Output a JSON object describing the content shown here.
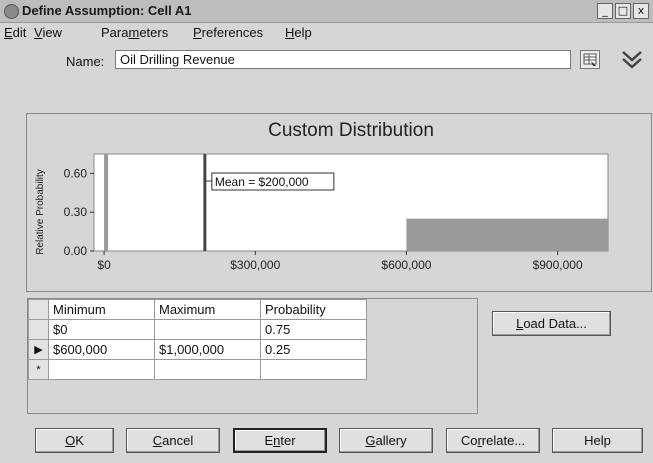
{
  "window": {
    "title": "Define Assumption: Cell A1",
    "controls": [
      "_",
      "□",
      "x"
    ]
  },
  "menu": {
    "items": [
      {
        "accel": "E",
        "rest": "dit"
      },
      {
        "accel": "V",
        "rest": "iew"
      },
      {
        "pre": "Para",
        "accel": "m",
        "rest": "eters"
      },
      {
        "accel": "P",
        "rest": "references"
      },
      {
        "accel": "H",
        "rest": "elp"
      }
    ]
  },
  "name_field": {
    "label": "Name:",
    "value": "Oil Drilling Revenue"
  },
  "chart_data": {
    "type": "bar",
    "title": "Custom Distribution",
    "ylabel": "Relative Probability",
    "xlabel": "",
    "y_ticks": [
      "0.60",
      "0.30",
      "0.00"
    ],
    "x_ticks": [
      "$0",
      "$300,000",
      "$600,000",
      "$900,000"
    ],
    "xlim": [
      -20000,
      1000000
    ],
    "ylim": [
      0,
      0.75
    ],
    "bars": [
      {
        "min": 0,
        "max": 0,
        "probability": 0.75
      },
      {
        "min": 600000,
        "max": 1000000,
        "probability": 0.25
      }
    ],
    "mean_value": 200000,
    "mean_label": "Mean = $200,000"
  },
  "table": {
    "headers": [
      "Minimum",
      "Maximum",
      "Probability"
    ],
    "rows": [
      {
        "marker": "",
        "cells": [
          "$0",
          "",
          "0.75"
        ]
      },
      {
        "marker": "▶",
        "cells": [
          "$600,000",
          "$1,000,000",
          "0.25"
        ]
      },
      {
        "marker": "*",
        "cells": [
          "",
          "",
          ""
        ]
      }
    ]
  },
  "buttons": {
    "load_data": {
      "accel": "L",
      "rest": "oad Data..."
    },
    "ok": {
      "accel": "O",
      "rest": "K"
    },
    "cancel": {
      "accel": "C",
      "rest": "ancel"
    },
    "enter": {
      "pre": "E",
      "accel": "n",
      "rest": "ter"
    },
    "gallery": {
      "accel": "G",
      "rest": "allery"
    },
    "correlate": {
      "pre": "Co",
      "accel": "r",
      "rest": "relate..."
    },
    "help": {
      "label": "Help"
    }
  }
}
